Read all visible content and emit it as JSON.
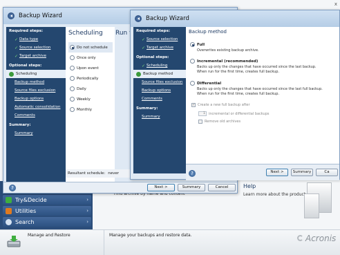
{
  "app": {
    "nav": [
      {
        "label": "Try&Decide",
        "icon": "shield-icon",
        "color": "#3fae3f"
      },
      {
        "label": "Utilities",
        "icon": "tools-icon",
        "color": "#e07a1f"
      },
      {
        "label": "Search",
        "icon": "search-icon",
        "color": "#d7e4f3"
      }
    ],
    "mid_text": "Find archive by name and content",
    "help_title": "Help",
    "help_text": "Learn more about the product.",
    "footer_label": "Manage and Restore",
    "footer_desc": "Manage your backups and restore data.",
    "logo": "Acronis",
    "window_ctrl": "x"
  },
  "wizard1": {
    "title": "Backup Wizard",
    "required_heading": "Required steps:",
    "required": [
      "Data type",
      "Source selection",
      "Target archive"
    ],
    "optional_heading": "Optional steps:",
    "current": "Scheduling",
    "optional": [
      "Backup method",
      "Source files exclusion",
      "Backup options",
      "Automatic consolidation",
      "Comments"
    ],
    "summary_heading": "Summary:",
    "summary": "Summary",
    "panel_title": "Scheduling",
    "run_the": "Run th",
    "schedule_options": [
      "Do not schedule",
      "Once only",
      "Upon event",
      "Periodically",
      "Daily",
      "Weekly",
      "Monthly"
    ],
    "selected_option": "Do not schedule",
    "resultant_label": "Resultant schedule:",
    "resultant_value": "never",
    "buttons": {
      "next": "Next >",
      "summary": "Summary",
      "cancel": "Cancel"
    }
  },
  "wizard2": {
    "title": "Backup Wizard",
    "required_heading": "Required steps:",
    "required": [
      "Source selection",
      "Target archive"
    ],
    "optional_heading": "Optional steps:",
    "scheduling": "Scheduling",
    "current": "Backup method",
    "optional": [
      "Source files exclusion",
      "Backup options",
      "Comments"
    ],
    "summary_heading": "Summary:",
    "summary": "Summary",
    "panel_title": "Backup method",
    "full_label": "Full",
    "full_desc": "Overwrites existing backup archive.",
    "incr_label": "Incremental (recommended)",
    "incr_desc1": "Backs up only the changes that have occurred since the last backup.",
    "incr_desc2": "When run for the first time, creates full backup.",
    "diff_label": "Differential",
    "diff_desc1": "Backs up only the changes that have occurred since the last full backup.",
    "diff_desc2": "When run for the first time, creates full backup.",
    "create_full_label": "Create a new full backup after",
    "spin_value": "1",
    "spin_label": "incremental or differential backups",
    "remove_old_label": "Remove old archives",
    "buttons": {
      "next": "Next >",
      "summary": "Summary",
      "cancel": "Ca"
    }
  }
}
